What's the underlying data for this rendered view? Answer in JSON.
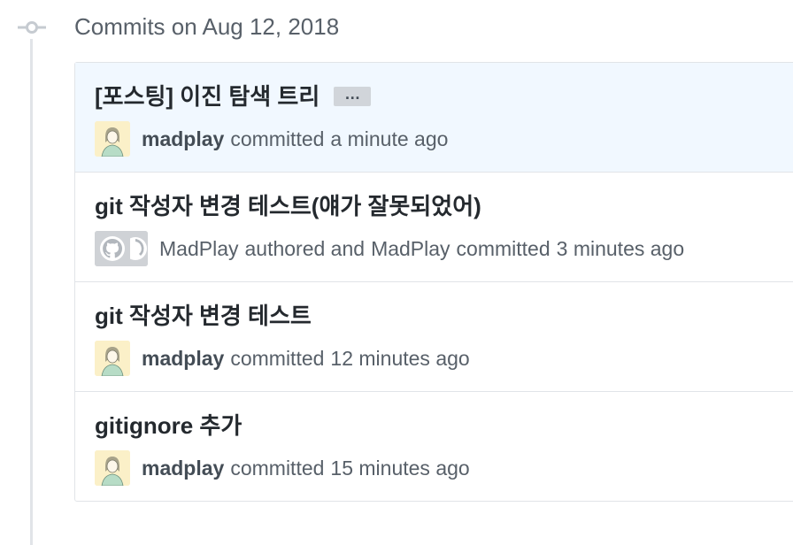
{
  "group": {
    "title": "Commits on Aug 12, 2018"
  },
  "commits": [
    {
      "title": "[포스팅] 이진 탐색 트리",
      "ellipsis": "…",
      "author": "madplay",
      "action": "committed",
      "time": "a minute ago"
    },
    {
      "title": "git 작성자 변경 테스트(얘가 잘못되었어)",
      "author": "MadPlay",
      "authored": "authored and",
      "committer": "MadPlay",
      "action": "committed",
      "time": "3 minutes ago"
    },
    {
      "title": "git 작성자 변경 테스트",
      "author": "madplay",
      "action": "committed",
      "time": "12 minutes ago"
    },
    {
      "title": "gitignore 추가",
      "author": "madplay",
      "action": "committed",
      "time": "15 minutes ago"
    }
  ],
  "icons": {
    "timeline": "commit-node-icon",
    "avatar": "user-avatar",
    "github": "github-octocat-icon"
  },
  "colors": {
    "highlight_row": "#f1f8ff",
    "border": "#e1e4e8",
    "text_primary": "#24292e",
    "text_secondary": "#586069"
  }
}
